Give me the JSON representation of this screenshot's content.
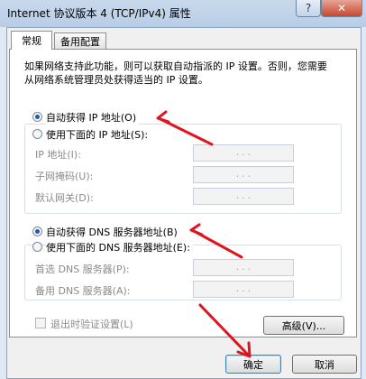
{
  "window": {
    "title": "Internet 协议版本 4 (TCP/IPv4) 属性",
    "help_glyph": "?",
    "close_glyph": "✕"
  },
  "tabs": [
    {
      "label": "常规"
    },
    {
      "label": "备用配置"
    }
  ],
  "description": "如果网络支持此功能，则可以获取自动指派的 IP 设置。否则，您需要从网络系统管理员处获得适当的 IP 设置。",
  "ip": {
    "auto_label": "自动获得 IP 地址(O)",
    "manual_label": "使用下面的 IP 地址(S):",
    "fields": [
      {
        "label": "IP 地址(I):"
      },
      {
        "label": "子网掩码(U):"
      },
      {
        "label": "默认网关(D):"
      }
    ]
  },
  "dns": {
    "auto_label": "自动获得 DNS 服务器地址(B)",
    "manual_label": "使用下面的 DNS 服务器地址(E):",
    "fields": [
      {
        "label": "首选 DNS 服务器(P):"
      },
      {
        "label": "备用 DNS 服务器(A):"
      }
    ]
  },
  "ip_dots": ".   .   .",
  "validate_label": "退出时验证设置(L)",
  "advanced_label": "高级(V)...",
  "ok_label": "确定",
  "cancel_label": "取消",
  "colors": {
    "arrow": "#e0141e",
    "radio_dot": "#1c59b8"
  }
}
